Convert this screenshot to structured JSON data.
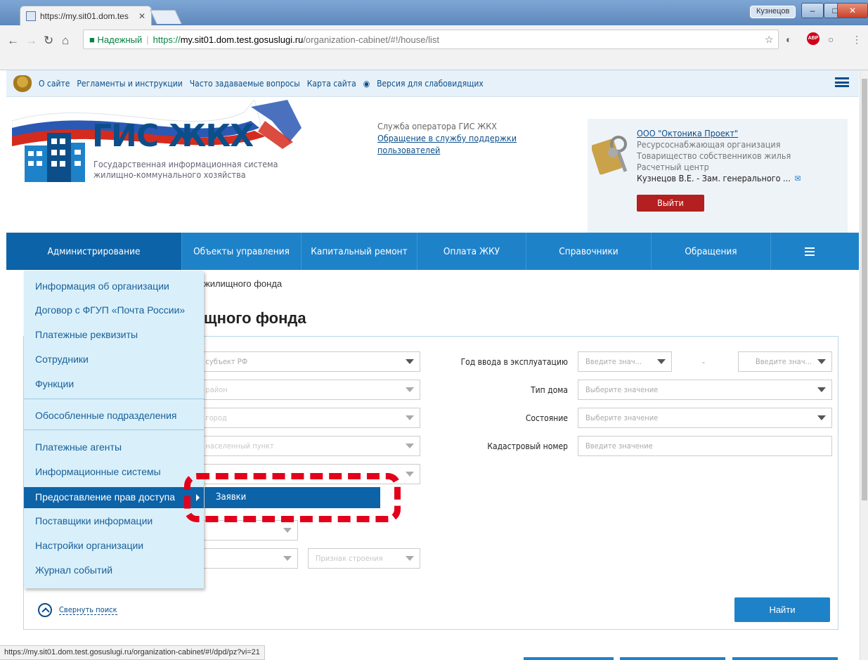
{
  "browser": {
    "tab_title": "https://my.sit01.dom.tes",
    "user_name": "Кузнецов",
    "secure_label": "Надежный",
    "url_scheme": "https://",
    "url_host": "my.sit01.dom.test.gosuslugi.ru",
    "url_path": "/organization-cabinet/#!/house/list",
    "status_url": "https://my.sit01.dom.test.gosuslugi.ru/organization-cabinet/#!/dpd/pz?vi=21"
  },
  "toplinks": [
    "О сайте",
    "Регламенты и инструкции",
    "Часто задаваемые вопросы",
    "Карта сайта",
    "Версия для слабовидящих"
  ],
  "header": {
    "logo_title": "ГИС ЖКХ",
    "logo_sub": "Государственная информационная система жилищно-коммунального хозяйства",
    "support_label": "Служба оператора ГИС ЖКХ",
    "support_link": "Обращение в службу поддержки пользователей",
    "org_name": "ООО \"Октоника Проект\"",
    "org_roles": [
      "Ресурсоснабжающая организация",
      "Товарищество собственников жилья",
      "Расчетный центр"
    ],
    "user": "Кузнецов В.Е. - Зам. генерального ...",
    "logout": "Выйти"
  },
  "nav": [
    "Администрирование",
    "Объекты управления",
    "Капитальный ремонт",
    "Оплата ЖКУ",
    "Справочники",
    "Обращения"
  ],
  "breadcrumb": "жилищного фонда",
  "page_title": "щного фонда",
  "filters": {
    "left": [
      "ите субъект РФ",
      "ите район",
      "ите город",
      "ите населенный пункт"
    ],
    "year_label": "Год ввода в эксплуатацию",
    "year_from": "Введите знач...",
    "year_to": "Введите знач...",
    "dash": "-",
    "house_type_label": "Тип дома",
    "house_type": "Выберите значение",
    "state_label": "Состояние",
    "state": "Выберите значение",
    "cadastre_label": "Кадастровый номер",
    "cadastre_placeholder": "Введите значение",
    "building_sign": "Признак строения",
    "collapse": "Свернуть поиск",
    "find": "Найти"
  },
  "menu": {
    "items": [
      "Информация об организации",
      "Договор с ФГУП «Почта России»",
      "Платежные реквизиты",
      "Сотрудники",
      "Функции",
      "Обособленные подразделения",
      "Платежные агенты",
      "Информационные системы",
      "Предоставление прав доступа",
      "Поставщики информации",
      "Настройки организации",
      "Журнал событий"
    ],
    "submenu": "Заявки"
  },
  "colors": {
    "brand_blue": "#1e82c9",
    "active_blue": "#0c63a8",
    "highlight_red": "#e3001b",
    "logout_red": "#b41f1f"
  }
}
